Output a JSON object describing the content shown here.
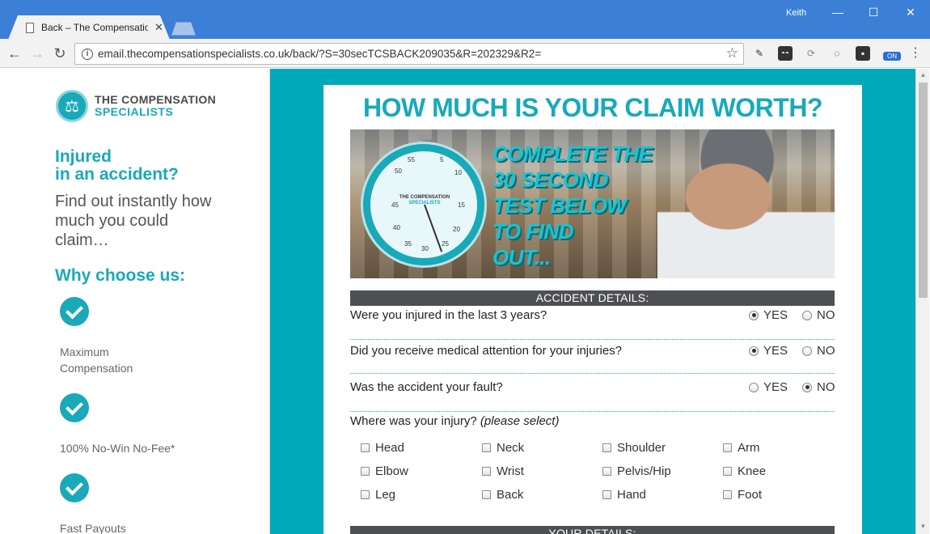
{
  "browser": {
    "tab_title": "Back – The Compensatio",
    "tab_close": "✕",
    "user": "Keith",
    "url": "email.thecompensationspecialists.co.uk/back/?S=30secTCSBACK209035&R=202329&R2=",
    "ext_on_label": "ON"
  },
  "sidebar": {
    "logo_line1": "THE COMPENSATION",
    "logo_line2": "SPECIALISTS",
    "injured_line1": "Injured",
    "injured_line2": "in an accident?",
    "find_out": "Find out instantly how much you could claim…",
    "why_title": "Why choose us:",
    "benefits": [
      {
        "line1": "Maximum",
        "line2": "Compensation"
      },
      {
        "line1": "100% No-Win No-Fee*",
        "line2": ""
      },
      {
        "line1": "Fast Payouts",
        "line2": ""
      }
    ]
  },
  "main": {
    "headline": "HOW MUCH IS YOUR CLAIM WORTH?",
    "hero_text_lines": [
      "COMPLETE THE",
      "30 SECOND",
      "TEST BELOW",
      "TO FIND",
      "OUT..."
    ],
    "watch_brand_1": "THE COMPENSATION",
    "watch_brand_2": "SPECIALISTS",
    "watch_numbers": [
      "55",
      "5",
      "50",
      "10",
      "45",
      "15",
      "40",
      "20",
      "35",
      "25",
      "30"
    ],
    "accident_section": "ACCIDENT DETAILS:",
    "questions": [
      {
        "text": "Were you injured in the last 3 years?",
        "yes": "YES",
        "no": "NO",
        "selected": "yes"
      },
      {
        "text": "Did you receive medical attention for your injuries?",
        "yes": "YES",
        "no": "NO",
        "selected": "yes"
      },
      {
        "text": "Was the accident your fault?",
        "yes": "YES",
        "no": "NO",
        "selected": "no"
      }
    ],
    "injury_prompt": "Where was your injury?",
    "injury_hint": "(please select)",
    "injuries": [
      "Head",
      "Neck",
      "Shoulder",
      "Arm",
      "Elbow",
      "Wrist",
      "Pelvis/Hip",
      "Knee",
      "Leg",
      "Back",
      "Hand",
      "Foot"
    ],
    "your_details_section": "YOUR DETAILS:"
  },
  "colors": {
    "brand_teal": "#19a9b9",
    "section_bar": "#4d4f52",
    "chrome_blue": "#3b7fd6"
  }
}
